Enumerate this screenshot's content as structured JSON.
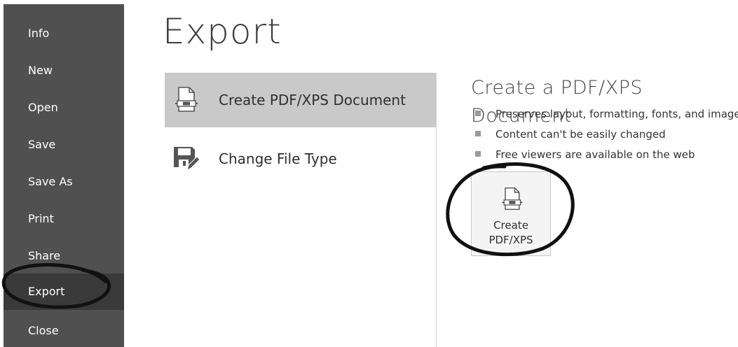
{
  "sidebar": {
    "items": [
      {
        "label": "Info"
      },
      {
        "label": "New"
      },
      {
        "label": "Open"
      },
      {
        "label": "Save"
      },
      {
        "label": "Save As"
      },
      {
        "label": "Print"
      },
      {
        "label": "Share"
      },
      {
        "label": "Export",
        "active": true
      },
      {
        "label": "Close"
      }
    ]
  },
  "main": {
    "title": "Export",
    "options": [
      {
        "label": "Create PDF/XPS Document",
        "icon": "pdf-document-icon",
        "selected": true
      },
      {
        "label": "Change File Type",
        "icon": "save-edit-icon",
        "selected": false
      }
    ]
  },
  "detail": {
    "title": "Create a PDF/XPS Document",
    "bullets": [
      "Preserves layout, formatting, fonts, and images",
      "Content can't be easily changed",
      "Free viewers are available on the web"
    ],
    "button": {
      "line1": "Create",
      "line2": "PDF/XPS",
      "icon": "pdf-document-icon"
    }
  },
  "colors": {
    "sidebar_bg": "#505050",
    "sidebar_active": "#3a3a3a",
    "selected_option_bg": "#c9c9c9",
    "annotation_stroke": "#111111"
  }
}
